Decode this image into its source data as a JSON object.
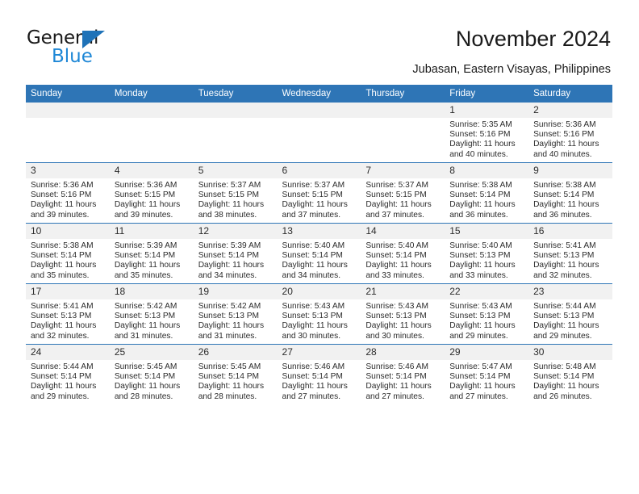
{
  "brand": {
    "line1": "General",
    "line2": "Blue",
    "triangle_color": "#1e72b8",
    "blue_text_color": "#1e87d6"
  },
  "header": {
    "title": "November 2024",
    "subtitle": "Jubasan, Eastern Visayas, Philippines"
  },
  "theme": {
    "header_blue": "#2e75b6",
    "daynum_band": "#f1f1f1",
    "text": "#2b2b2b"
  },
  "calendar": {
    "weekday_headers": [
      "Sunday",
      "Monday",
      "Tuesday",
      "Wednesday",
      "Thursday",
      "Friday",
      "Saturday"
    ],
    "labels": {
      "sunrise": "Sunrise:",
      "sunset": "Sunset:",
      "daylight": "Daylight:"
    },
    "weeks": [
      [
        {
          "day": "",
          "sunrise": "",
          "sunset": "",
          "daylight": ""
        },
        {
          "day": "",
          "sunrise": "",
          "sunset": "",
          "daylight": ""
        },
        {
          "day": "",
          "sunrise": "",
          "sunset": "",
          "daylight": ""
        },
        {
          "day": "",
          "sunrise": "",
          "sunset": "",
          "daylight": ""
        },
        {
          "day": "",
          "sunrise": "",
          "sunset": "",
          "daylight": ""
        },
        {
          "day": "1",
          "sunrise": "Sunrise: 5:35 AM",
          "sunset": "Sunset: 5:16 PM",
          "daylight": "Daylight: 11 hours and 40 minutes."
        },
        {
          "day": "2",
          "sunrise": "Sunrise: 5:36 AM",
          "sunset": "Sunset: 5:16 PM",
          "daylight": "Daylight: 11 hours and 40 minutes."
        }
      ],
      [
        {
          "day": "3",
          "sunrise": "Sunrise: 5:36 AM",
          "sunset": "Sunset: 5:16 PM",
          "daylight": "Daylight: 11 hours and 39 minutes."
        },
        {
          "day": "4",
          "sunrise": "Sunrise: 5:36 AM",
          "sunset": "Sunset: 5:15 PM",
          "daylight": "Daylight: 11 hours and 39 minutes."
        },
        {
          "day": "5",
          "sunrise": "Sunrise: 5:37 AM",
          "sunset": "Sunset: 5:15 PM",
          "daylight": "Daylight: 11 hours and 38 minutes."
        },
        {
          "day": "6",
          "sunrise": "Sunrise: 5:37 AM",
          "sunset": "Sunset: 5:15 PM",
          "daylight": "Daylight: 11 hours and 37 minutes."
        },
        {
          "day": "7",
          "sunrise": "Sunrise: 5:37 AM",
          "sunset": "Sunset: 5:15 PM",
          "daylight": "Daylight: 11 hours and 37 minutes."
        },
        {
          "day": "8",
          "sunrise": "Sunrise: 5:38 AM",
          "sunset": "Sunset: 5:14 PM",
          "daylight": "Daylight: 11 hours and 36 minutes."
        },
        {
          "day": "9",
          "sunrise": "Sunrise: 5:38 AM",
          "sunset": "Sunset: 5:14 PM",
          "daylight": "Daylight: 11 hours and 36 minutes."
        }
      ],
      [
        {
          "day": "10",
          "sunrise": "Sunrise: 5:38 AM",
          "sunset": "Sunset: 5:14 PM",
          "daylight": "Daylight: 11 hours and 35 minutes."
        },
        {
          "day": "11",
          "sunrise": "Sunrise: 5:39 AM",
          "sunset": "Sunset: 5:14 PM",
          "daylight": "Daylight: 11 hours and 35 minutes."
        },
        {
          "day": "12",
          "sunrise": "Sunrise: 5:39 AM",
          "sunset": "Sunset: 5:14 PM",
          "daylight": "Daylight: 11 hours and 34 minutes."
        },
        {
          "day": "13",
          "sunrise": "Sunrise: 5:40 AM",
          "sunset": "Sunset: 5:14 PM",
          "daylight": "Daylight: 11 hours and 34 minutes."
        },
        {
          "day": "14",
          "sunrise": "Sunrise: 5:40 AM",
          "sunset": "Sunset: 5:14 PM",
          "daylight": "Daylight: 11 hours and 33 minutes."
        },
        {
          "day": "15",
          "sunrise": "Sunrise: 5:40 AM",
          "sunset": "Sunset: 5:13 PM",
          "daylight": "Daylight: 11 hours and 33 minutes."
        },
        {
          "day": "16",
          "sunrise": "Sunrise: 5:41 AM",
          "sunset": "Sunset: 5:13 PM",
          "daylight": "Daylight: 11 hours and 32 minutes."
        }
      ],
      [
        {
          "day": "17",
          "sunrise": "Sunrise: 5:41 AM",
          "sunset": "Sunset: 5:13 PM",
          "daylight": "Daylight: 11 hours and 32 minutes."
        },
        {
          "day": "18",
          "sunrise": "Sunrise: 5:42 AM",
          "sunset": "Sunset: 5:13 PM",
          "daylight": "Daylight: 11 hours and 31 minutes."
        },
        {
          "day": "19",
          "sunrise": "Sunrise: 5:42 AM",
          "sunset": "Sunset: 5:13 PM",
          "daylight": "Daylight: 11 hours and 31 minutes."
        },
        {
          "day": "20",
          "sunrise": "Sunrise: 5:43 AM",
          "sunset": "Sunset: 5:13 PM",
          "daylight": "Daylight: 11 hours and 30 minutes."
        },
        {
          "day": "21",
          "sunrise": "Sunrise: 5:43 AM",
          "sunset": "Sunset: 5:13 PM",
          "daylight": "Daylight: 11 hours and 30 minutes."
        },
        {
          "day": "22",
          "sunrise": "Sunrise: 5:43 AM",
          "sunset": "Sunset: 5:13 PM",
          "daylight": "Daylight: 11 hours and 29 minutes."
        },
        {
          "day": "23",
          "sunrise": "Sunrise: 5:44 AM",
          "sunset": "Sunset: 5:13 PM",
          "daylight": "Daylight: 11 hours and 29 minutes."
        }
      ],
      [
        {
          "day": "24",
          "sunrise": "Sunrise: 5:44 AM",
          "sunset": "Sunset: 5:14 PM",
          "daylight": "Daylight: 11 hours and 29 minutes."
        },
        {
          "day": "25",
          "sunrise": "Sunrise: 5:45 AM",
          "sunset": "Sunset: 5:14 PM",
          "daylight": "Daylight: 11 hours and 28 minutes."
        },
        {
          "day": "26",
          "sunrise": "Sunrise: 5:45 AM",
          "sunset": "Sunset: 5:14 PM",
          "daylight": "Daylight: 11 hours and 28 minutes."
        },
        {
          "day": "27",
          "sunrise": "Sunrise: 5:46 AM",
          "sunset": "Sunset: 5:14 PM",
          "daylight": "Daylight: 11 hours and 27 minutes."
        },
        {
          "day": "28",
          "sunrise": "Sunrise: 5:46 AM",
          "sunset": "Sunset: 5:14 PM",
          "daylight": "Daylight: 11 hours and 27 minutes."
        },
        {
          "day": "29",
          "sunrise": "Sunrise: 5:47 AM",
          "sunset": "Sunset: 5:14 PM",
          "daylight": "Daylight: 11 hours and 27 minutes."
        },
        {
          "day": "30",
          "sunrise": "Sunrise: 5:48 AM",
          "sunset": "Sunset: 5:14 PM",
          "daylight": "Daylight: 11 hours and 26 minutes."
        }
      ]
    ]
  }
}
